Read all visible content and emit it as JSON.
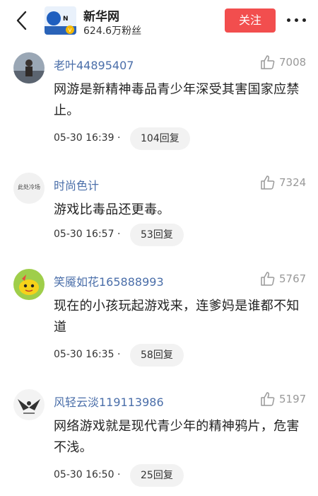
{
  "header": {
    "account_name": "新华网",
    "followers": "624.6万粉丝",
    "follow_label": "关注",
    "logo_text": "新华网"
  },
  "comments": [
    {
      "user": "老叶44895407",
      "likes": "7008",
      "text": "网游是新精神毒品青少年深受其害国家应禁止。",
      "time": "05-30 16:39",
      "dot": "·",
      "replies": "104回复"
    },
    {
      "user": "时尚色计",
      "likes": "7324",
      "text": "游戏比毒品还更毒。",
      "time": "05-30 16:57",
      "dot": "·",
      "replies": "53回复",
      "avatar_text": "此处冷场"
    },
    {
      "user": "笑魇如花165888993",
      "likes": "5767",
      "text": "现在的小孩玩起游戏来，连爹妈是谁都不知道",
      "time": "05-30 16:35",
      "dot": "·",
      "replies": "58回复"
    },
    {
      "user": "风轻云淡119113986",
      "likes": "5197",
      "text": "网络游戏就是现代青少年的精神鸦片，危害不浅。",
      "time": "05-30 16:50",
      "dot": "·",
      "replies": "25回复"
    }
  ]
}
